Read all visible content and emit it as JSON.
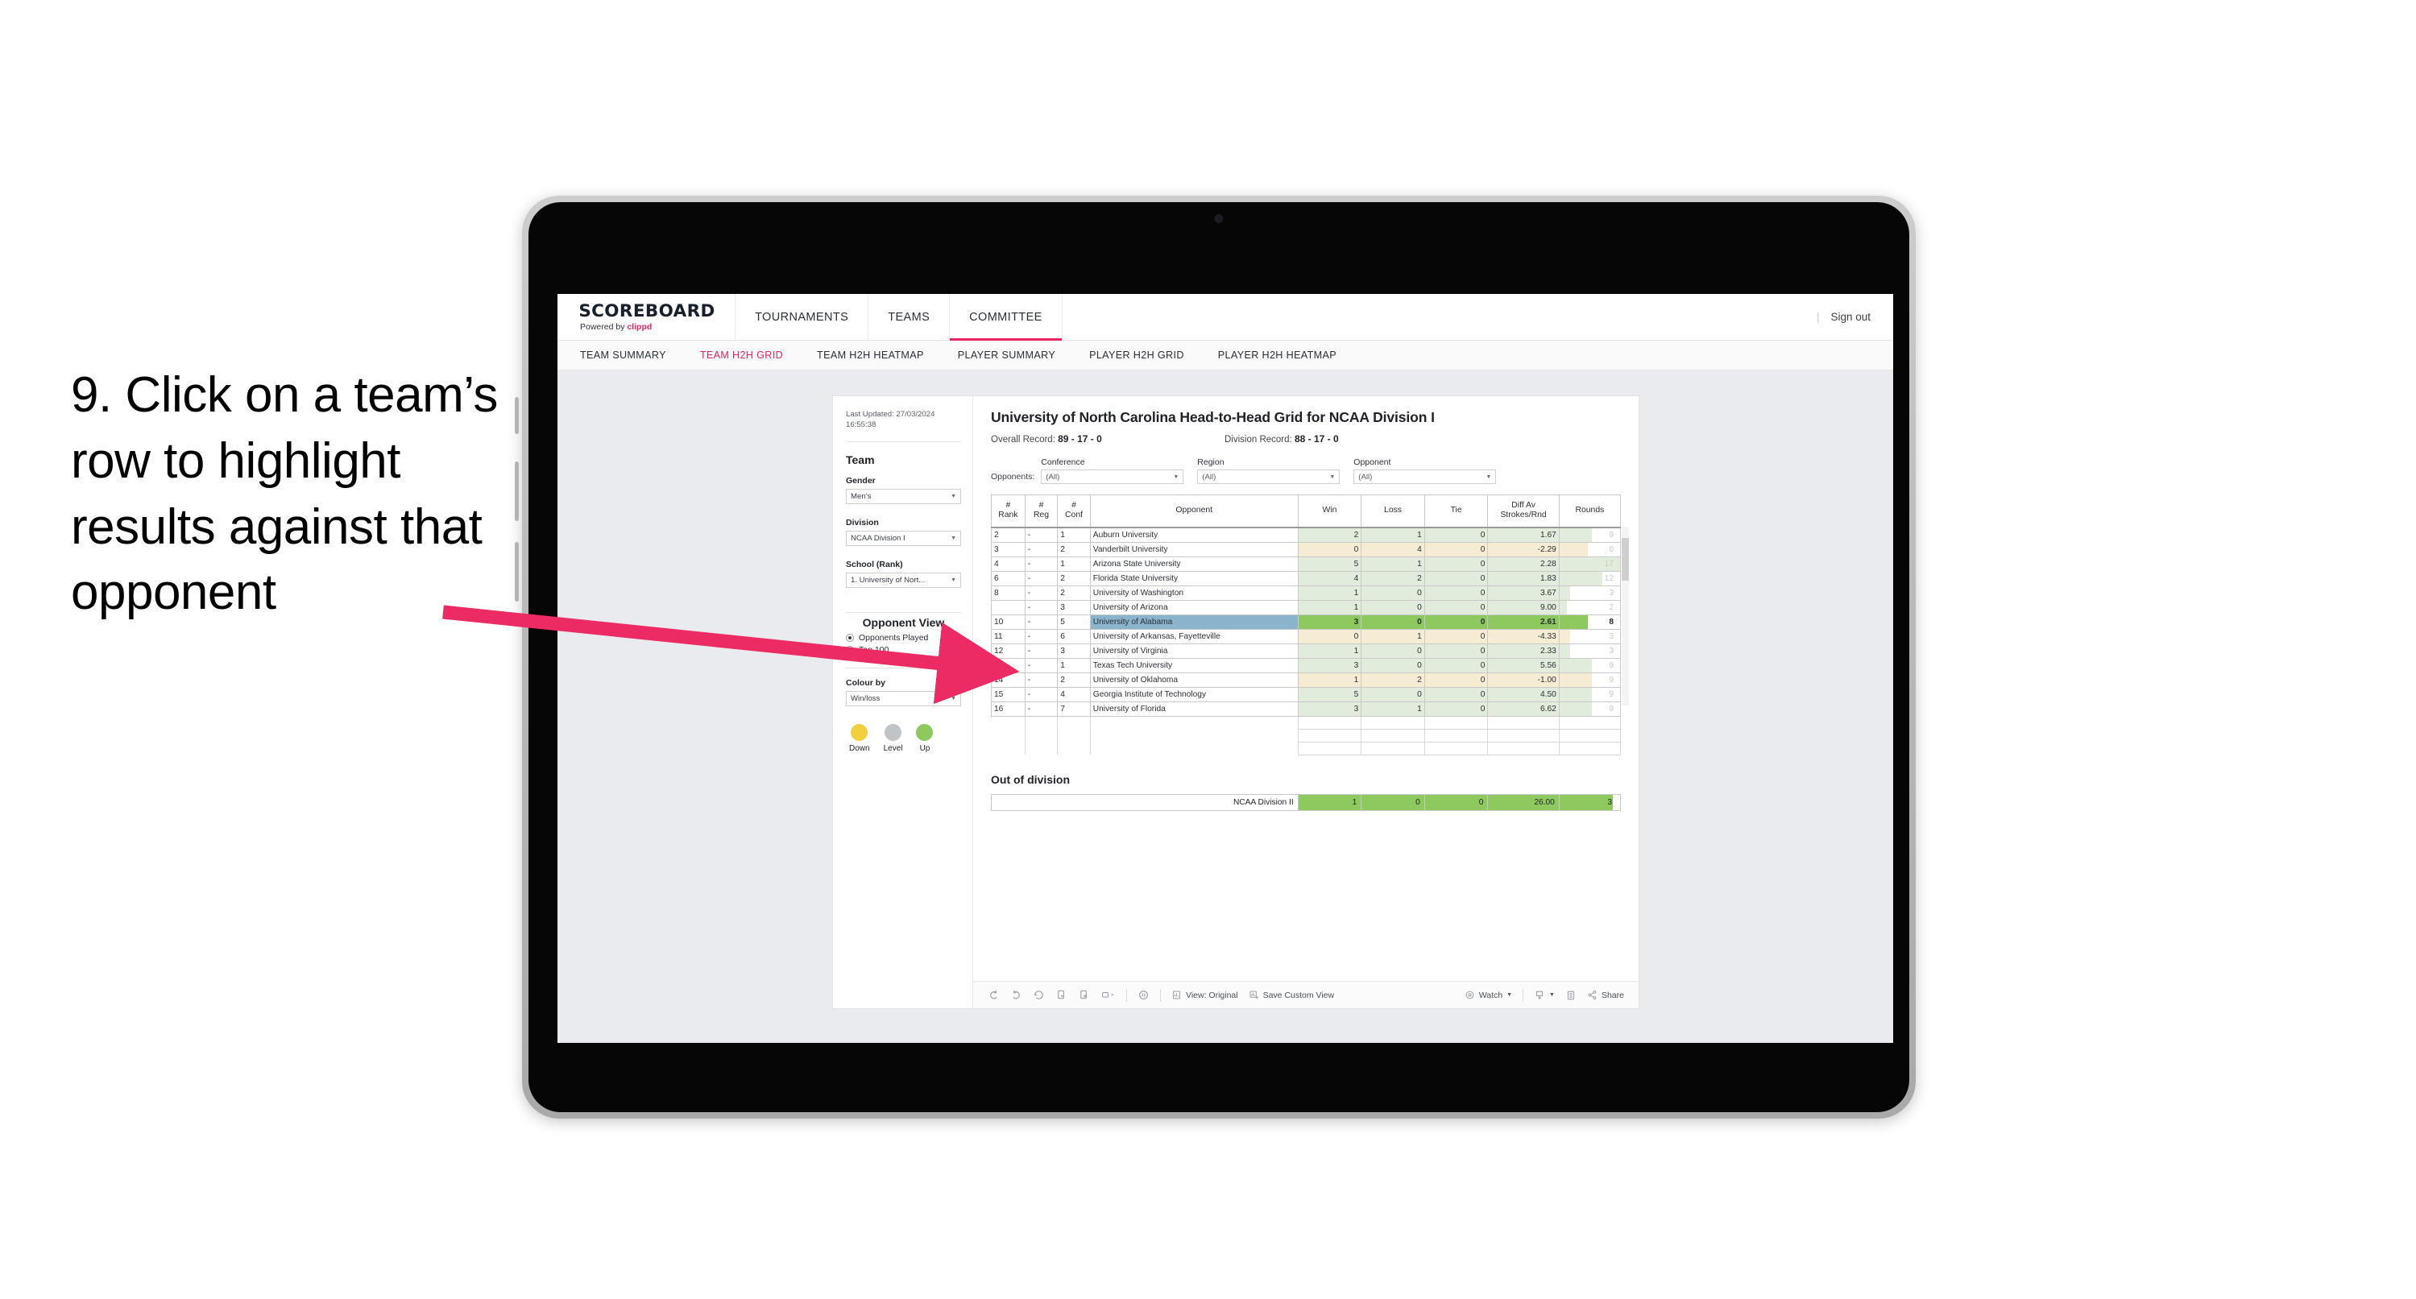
{
  "annotation": {
    "step_text": "9. Click on a team’s row to highlight results against that opponent",
    "arrow_color": "#ec2a63"
  },
  "topnav": {
    "brand_title": "SCOREBOARD",
    "brand_sub_prefix": "Powered by ",
    "brand_sub_link": "clippd",
    "items": [
      {
        "label": "TOURNAMENTS",
        "active": false
      },
      {
        "label": "TEAMS",
        "active": false
      },
      {
        "label": "COMMITTEE",
        "active": true
      }
    ],
    "divider": "|",
    "sign_out": "Sign out"
  },
  "subnav": {
    "items": [
      {
        "label": "TEAM SUMMARY",
        "active": false
      },
      {
        "label": "TEAM H2H GRID",
        "active": true
      },
      {
        "label": "TEAM H2H HEATMAP",
        "active": false
      },
      {
        "label": "PLAYER SUMMARY",
        "active": false
      },
      {
        "label": "PLAYER H2H GRID",
        "active": false
      },
      {
        "label": "PLAYER H2H HEATMAP",
        "active": false
      }
    ]
  },
  "sidebar": {
    "last_updated": "Last Updated: 27/03/2024 16:55:38",
    "team_heading": "Team",
    "gender_label": "Gender",
    "gender_value": "Men’s",
    "division_label": "Division",
    "division_value": "NCAA Division I",
    "school_label": "School (Rank)",
    "school_value": "1. University of Nort...",
    "opponent_view_heading": "Opponent View",
    "opponent_view_options": [
      {
        "label": "Opponents Played",
        "selected": true
      },
      {
        "label": "Top 100",
        "selected": false
      }
    ],
    "colour_by_label": "Colour by",
    "colour_by_value": "Win/loss",
    "legend": [
      {
        "label": "Down",
        "color": "#f2cf3c"
      },
      {
        "label": "Level",
        "color": "#c0c4c6"
      },
      {
        "label": "Up",
        "color": "#8ec960"
      }
    ]
  },
  "dashboard": {
    "title": "University of North Carolina Head-to-Head Grid for NCAA Division I",
    "overall_record_label": "Overall Record:",
    "overall_record_value": "89 - 17 - 0",
    "division_record_label": "Division Record:",
    "division_record_value": "88 - 17 - 0",
    "opponents_label": "Opponents:",
    "filters": [
      {
        "label": "Conference",
        "value": "(All)"
      },
      {
        "label": "Region",
        "value": "(All)"
      },
      {
        "label": "Opponent",
        "value": "(All)"
      }
    ],
    "columns": [
      "# Rank",
      "# Reg",
      "# Conf",
      "Opponent",
      "Win",
      "Loss",
      "Tie",
      "Diff Av Strokes/Rnd",
      "Rounds"
    ],
    "columns_split": {
      "rank": [
        "#",
        "Rank"
      ],
      "reg": [
        "#",
        "Reg"
      ],
      "conf": [
        "#",
        "Conf"
      ],
      "opponent": "Opponent",
      "win": "Win",
      "loss": "Loss",
      "tie": "Tie",
      "diff": [
        "Diff Av",
        "Strokes/Rnd"
      ],
      "rounds": "Rounds"
    },
    "rows": [
      {
        "rank": "2",
        "reg": "-",
        "conf": "1",
        "opponent": "Auburn University",
        "win": "2",
        "loss": "1",
        "tie": "0",
        "diff": "1.67",
        "rounds": "9",
        "result": "win",
        "selected": false,
        "bar_pct": 53
      },
      {
        "rank": "3",
        "reg": "-",
        "conf": "2",
        "opponent": "Vanderbilt University",
        "win": "0",
        "loss": "4",
        "tie": "0",
        "diff": "-2.29",
        "rounds": "8",
        "result": "loss",
        "selected": false,
        "bar_pct": 47
      },
      {
        "rank": "4",
        "reg": "-",
        "conf": "1",
        "opponent": "Arizona State University",
        "win": "5",
        "loss": "1",
        "tie": "0",
        "diff": "2.28",
        "rounds": "17",
        "result": "win",
        "selected": false,
        "bar_pct": 100
      },
      {
        "rank": "6",
        "reg": "-",
        "conf": "2",
        "opponent": "Florida State University",
        "win": "4",
        "loss": "2",
        "tie": "0",
        "diff": "1.83",
        "rounds": "12",
        "result": "win",
        "selected": false,
        "bar_pct": 71
      },
      {
        "rank": "8",
        "reg": "-",
        "conf": "2",
        "opponent": "University of Washington",
        "win": "1",
        "loss": "0",
        "tie": "0",
        "diff": "3.67",
        "rounds": "3",
        "result": "win",
        "selected": false,
        "bar_pct": 18
      },
      {
        "rank": "",
        "reg": "-",
        "conf": "3",
        "opponent": "University of Arizona",
        "win": "1",
        "loss": "0",
        "tie": "0",
        "diff": "9.00",
        "rounds": "2",
        "result": "win",
        "selected": false,
        "bar_pct": 12
      },
      {
        "rank": "10",
        "reg": "-",
        "conf": "5",
        "opponent": "University of Alabama",
        "win": "3",
        "loss": "0",
        "tie": "0",
        "diff": "2.61",
        "rounds": "8",
        "result": "win",
        "selected": true,
        "bar_pct": 47
      },
      {
        "rank": "11",
        "reg": "-",
        "conf": "6",
        "opponent": "University of Arkansas, Fayetteville",
        "win": "0",
        "loss": "1",
        "tie": "0",
        "diff": "-4.33",
        "rounds": "3",
        "result": "loss",
        "selected": false,
        "bar_pct": 18
      },
      {
        "rank": "12",
        "reg": "-",
        "conf": "3",
        "opponent": "University of Virginia",
        "win": "1",
        "loss": "0",
        "tie": "0",
        "diff": "2.33",
        "rounds": "3",
        "result": "win",
        "selected": false,
        "bar_pct": 18
      },
      {
        "rank": "13",
        "reg": "-",
        "conf": "1",
        "opponent": "Texas Tech University",
        "win": "3",
        "loss": "0",
        "tie": "0",
        "diff": "5.56",
        "rounds": "9",
        "result": "win",
        "selected": false,
        "bar_pct": 53
      },
      {
        "rank": "14",
        "reg": "-",
        "conf": "2",
        "opponent": "University of Oklahoma",
        "win": "1",
        "loss": "2",
        "tie": "0",
        "diff": "-1.00",
        "rounds": "9",
        "result": "loss",
        "selected": false,
        "bar_pct": 53
      },
      {
        "rank": "15",
        "reg": "-",
        "conf": "4",
        "opponent": "Georgia Institute of Technology",
        "win": "5",
        "loss": "0",
        "tie": "0",
        "diff": "4.50",
        "rounds": "9",
        "result": "win",
        "selected": false,
        "bar_pct": 53
      },
      {
        "rank": "16",
        "reg": "-",
        "conf": "7",
        "opponent": "University of Florida",
        "win": "3",
        "loss": "1",
        "tie": "0",
        "diff": "6.62",
        "rounds": "9",
        "result": "win",
        "selected": false,
        "bar_pct": 53
      }
    ],
    "out_of_division_title": "Out of division",
    "out_of_division_row": {
      "name": "NCAA Division II",
      "win": "1",
      "loss": "0",
      "tie": "0",
      "diff": "26.00",
      "rounds": "3",
      "bar_pct": 88
    }
  },
  "toolbar": {
    "view_label": "View: Original",
    "save_custom_view_label": "Save Custom View",
    "watch_label": "Watch",
    "share_label": "Share",
    "divider": "|"
  },
  "chart_data": {
    "type": "table",
    "title": "University of North Carolina Head-to-Head Grid for NCAA Division I",
    "columns": [
      "# Rank",
      "# Reg",
      "# Conf",
      "Opponent",
      "Win",
      "Loss",
      "Tie",
      "Diff Av Strokes/Rnd",
      "Rounds"
    ],
    "rows": [
      [
        "2",
        "-",
        "1",
        "Auburn University",
        2,
        1,
        0,
        1.67,
        9
      ],
      [
        "3",
        "-",
        "2",
        "Vanderbilt University",
        0,
        4,
        0,
        -2.29,
        8
      ],
      [
        "4",
        "-",
        "1",
        "Arizona State University",
        5,
        1,
        0,
        2.28,
        17
      ],
      [
        "6",
        "-",
        "2",
        "Florida State University",
        4,
        2,
        0,
        1.83,
        12
      ],
      [
        "8",
        "-",
        "2",
        "University of Washington",
        1,
        0,
        0,
        3.67,
        3
      ],
      [
        "",
        "-",
        "3",
        "University of Arizona",
        1,
        0,
        0,
        9.0,
        2
      ],
      [
        "10",
        "-",
        "5",
        "University of Alabama",
        3,
        0,
        0,
        2.61,
        8
      ],
      [
        "11",
        "-",
        "6",
        "University of Arkansas, Fayetteville",
        0,
        1,
        0,
        -4.33,
        3
      ],
      [
        "12",
        "-",
        "3",
        "University of Virginia",
        1,
        0,
        0,
        2.33,
        3
      ],
      [
        "13",
        "-",
        "1",
        "Texas Tech University",
        3,
        0,
        0,
        5.56,
        9
      ],
      [
        "14",
        "-",
        "2",
        "University of Oklahoma",
        1,
        2,
        0,
        -1.0,
        9
      ],
      [
        "15",
        "-",
        "4",
        "Georgia Institute of Technology",
        5,
        0,
        0,
        4.5,
        9
      ],
      [
        "16",
        "-",
        "7",
        "University of Florida",
        3,
        1,
        0,
        6.62,
        9
      ]
    ],
    "out_of_division": [
      [
        "NCAA Division II",
        1,
        0,
        0,
        26.0,
        3
      ]
    ],
    "selected_row_index": 6,
    "colour_encoding": {
      "win": "#e1ecdc",
      "loss": "#f6ecd3",
      "selected": "#8ec960",
      "selected_label": "#8ab3cc"
    },
    "overall_record": "89 - 17 - 0",
    "division_record": "88 - 17 - 0"
  }
}
